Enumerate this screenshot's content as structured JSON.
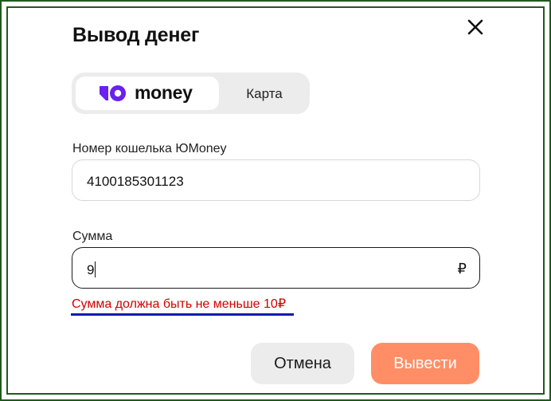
{
  "dialog": {
    "title": "Вывод денег"
  },
  "method_toggle": {
    "options": [
      {
        "label": "money",
        "selected": true
      },
      {
        "label": "Карта",
        "selected": false
      }
    ]
  },
  "wallet": {
    "label": "Номер кошелька ЮMoney",
    "value": "4100185301123"
  },
  "amount": {
    "label": "Сумма",
    "value": "9",
    "currency": "₽",
    "error": "Сумма должна быть не меньше 10₽"
  },
  "actions": {
    "cancel_label": "Отмена",
    "submit_label": "Вывести"
  },
  "colors": {
    "brand_purple": "#6a20f0",
    "submit_bg": "#ff8e66",
    "error": "#d10000",
    "frame_green": "#1f5a1f"
  },
  "icons": {
    "close": "close-icon",
    "yoomoney_logo": "yoomoney-logo-icon"
  }
}
